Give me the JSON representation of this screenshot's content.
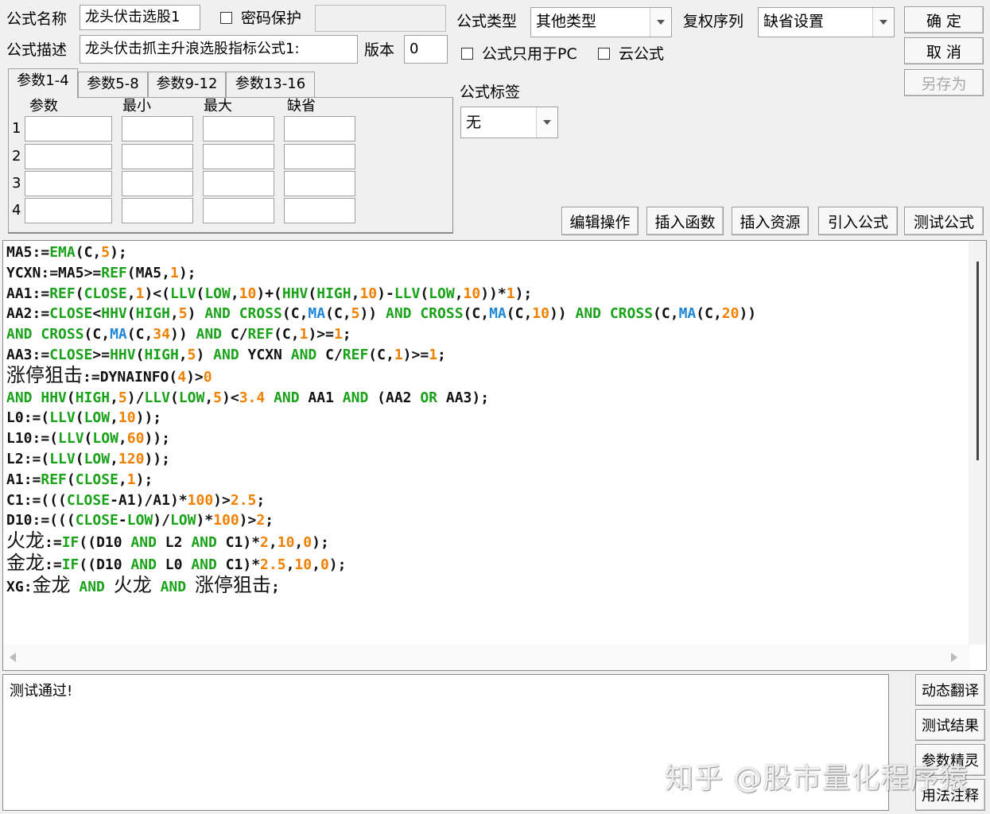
{
  "header": {
    "formula_name_label": "公式名称",
    "formula_name_value": "龙头伏击选股1",
    "password_label": "密码保护",
    "password_value": "",
    "description_label": "公式描述",
    "description_value": "龙头伏击抓主升浪选股指标公式1:",
    "version_label": "版本",
    "version_value": "0",
    "formula_type_label": "公式类型",
    "formula_type_value": "其他类型",
    "rights_label": "复权序列",
    "rights_value": "缺省设置",
    "pc_only_label": "公式只用于PC",
    "cloud_label": "云公式",
    "tag_label": "公式标签",
    "tag_value": "无"
  },
  "buttons": {
    "ok": "确 定",
    "cancel": "取 消",
    "save_as": "另存为",
    "edit_ops": "编辑操作",
    "insert_func": "插入函数",
    "insert_res": "插入资源",
    "import_formula": "引入公式",
    "test_formula": "测试公式"
  },
  "tabs": [
    "参数1-4",
    "参数5-8",
    "参数9-12",
    "参数13-16"
  ],
  "params": {
    "headers": [
      "参数",
      "最小",
      "最大",
      "缺省"
    ],
    "rows": [
      "1",
      "2",
      "3",
      "4"
    ]
  },
  "code_lines": [
    "MA5:=EMA(C,5);",
    "YCXN:=MA5>=REF(MA5,1);",
    "AA1:=REF(CLOSE,1)<(LLV(LOW,10)+(HHV(HIGH,10)-LLV(LOW,10))*1);",
    "AA2:=CLOSE<HHV(HIGH,5) AND CROSS(C,MA(C,5)) AND CROSS(C,MA(C,10)) AND CROSS(C,MA(C,20))",
    "AND CROSS(C,MA(C,34)) AND C/REF(C,1)>=1;",
    "AA3:=CLOSE>=HHV(HIGH,5) AND YCXN AND C/REF(C,1)>=1;",
    "涨停狙击:=DYNAINFO(4)>0",
    "AND HHV(HIGH,5)/LLV(LOW,5)<3.4 AND AA1 AND (AA2 OR AA3);",
    "L0:=(LLV(LOW,10));",
    "L10:=(LLV(LOW,60));",
    "L2:=(LLV(LOW,120));",
    "A1:=REF(CLOSE,1);",
    "C1:=(((CLOSE-A1)/A1)*100)>2.5;",
    "D10:=(((CLOSE-LOW)/LOW)*100)>2;",
    "火龙:=IF((D10 AND L2 AND C1)*2,10,0);",
    "金龙:=IF((D10 AND L0 AND C1)*2.5,10,0);",
    "XG:金龙 AND 火龙 AND 涨停狙击;"
  ],
  "output_text": "测试通过!",
  "side_buttons": [
    "动态翻译",
    "测试结果",
    "参数精灵",
    "用法注释"
  ],
  "watermark": "知乎 @股市量化程序猿",
  "colors": {
    "function": "#1aa21a",
    "number": "#f08000",
    "ma": "#1f86d6",
    "text": "#111111"
  }
}
